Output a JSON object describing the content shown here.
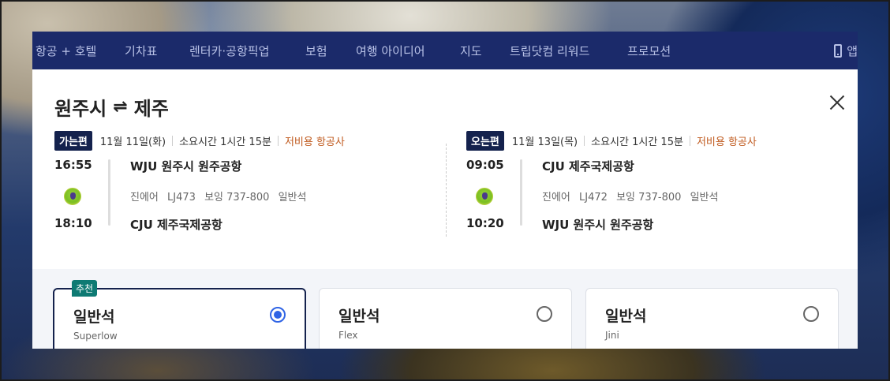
{
  "nav": {
    "items": [
      "항공 + 호텔",
      "기차표",
      "렌터카·공항픽업",
      "보험",
      "여행 아이디어",
      "지도",
      "트립닷컴 리워드",
      "프로모션"
    ],
    "app_label": "앱"
  },
  "route": {
    "origin": "원주시",
    "swap_symbol": "⇌",
    "destination": "제주"
  },
  "outbound": {
    "badge": "가는편",
    "date": "11월 11일(화)",
    "duration": "소요시간 1시간 15분",
    "airline_type": "저비용 항공사",
    "dep_time": "16:55",
    "arr_time": "18:10",
    "dep_airport": "WJU 원주시 원주공항",
    "arr_airport": "CJU 제주국제공항",
    "airline": "진에어",
    "flight_no": "LJ473",
    "aircraft": "보잉 737-800",
    "cabin": "일반석"
  },
  "inbound": {
    "badge": "오는편",
    "date": "11월 13일(목)",
    "duration": "소요시간 1시간 15분",
    "airline_type": "저비용 항공사",
    "dep_time": "09:05",
    "arr_time": "10:20",
    "dep_airport": "CJU 제주국제공항",
    "arr_airport": "WJU 원주시 원주공항",
    "airline": "진에어",
    "flight_no": "LJ472",
    "aircraft": "보잉 737-800",
    "cabin": "일반석"
  },
  "fares": [
    {
      "name": "일반석",
      "sub": "Superlow",
      "selected": true,
      "badge": "추천"
    },
    {
      "name": "일반석",
      "sub": "Flex",
      "selected": false
    },
    {
      "name": "일반석",
      "sub": "Jini",
      "selected": false
    }
  ],
  "colors": {
    "nav_bg": "#1b2a6a",
    "badge_bg": "#14224d",
    "lowcost": "#c05a1e",
    "radio_selected": "#2f64e5",
    "rec_badge": "#0e7a73"
  }
}
